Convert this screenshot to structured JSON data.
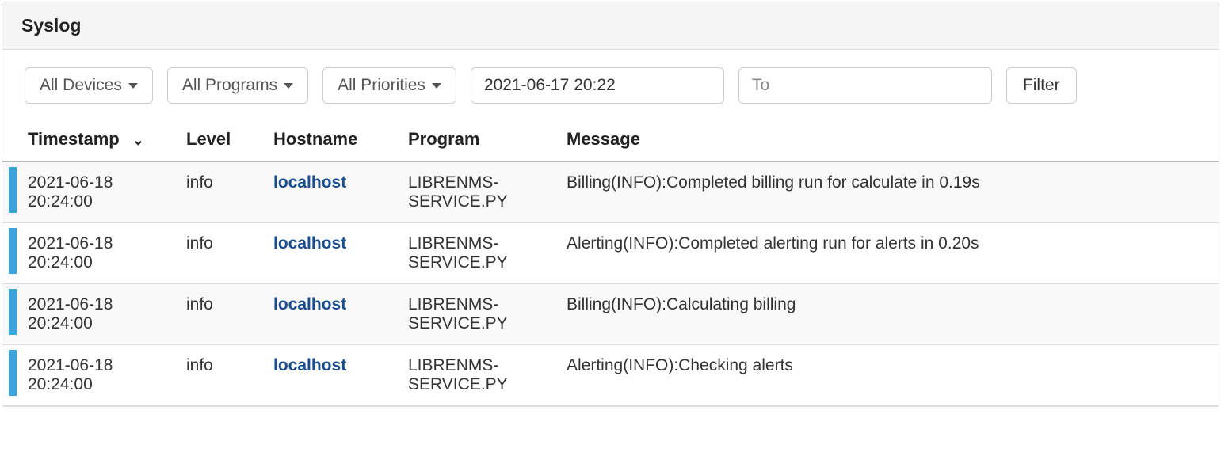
{
  "panel": {
    "title": "Syslog"
  },
  "filters": {
    "devices": "All Devices",
    "programs": "All Programs",
    "priorities": "All Priorities",
    "from_value": "2021-06-17 20:22",
    "to_placeholder": "To",
    "filter_label": "Filter"
  },
  "columns": {
    "timestamp": "Timestamp",
    "level": "Level",
    "hostname": "Hostname",
    "program": "Program",
    "message": "Message"
  },
  "rows": [
    {
      "timestamp": "2021-06-18 20:24:00",
      "level": "info",
      "hostname": "localhost",
      "program": "LIBRENMS-SERVICE.PY",
      "message": "Billing(INFO):Completed billing run for calculate in 0.19s"
    },
    {
      "timestamp": "2021-06-18 20:24:00",
      "level": "info",
      "hostname": "localhost",
      "program": "LIBRENMS-SERVICE.PY",
      "message": "Alerting(INFO):Completed alerting run for alerts in 0.20s"
    },
    {
      "timestamp": "2021-06-18 20:24:00",
      "level": "info",
      "hostname": "localhost",
      "program": "LIBRENMS-SERVICE.PY",
      "message": "Billing(INFO):Calculating billing"
    },
    {
      "timestamp": "2021-06-18 20:24:00",
      "level": "info",
      "hostname": "localhost",
      "program": "LIBRENMS-SERVICE.PY",
      "message": "Alerting(INFO):Checking alerts"
    }
  ]
}
